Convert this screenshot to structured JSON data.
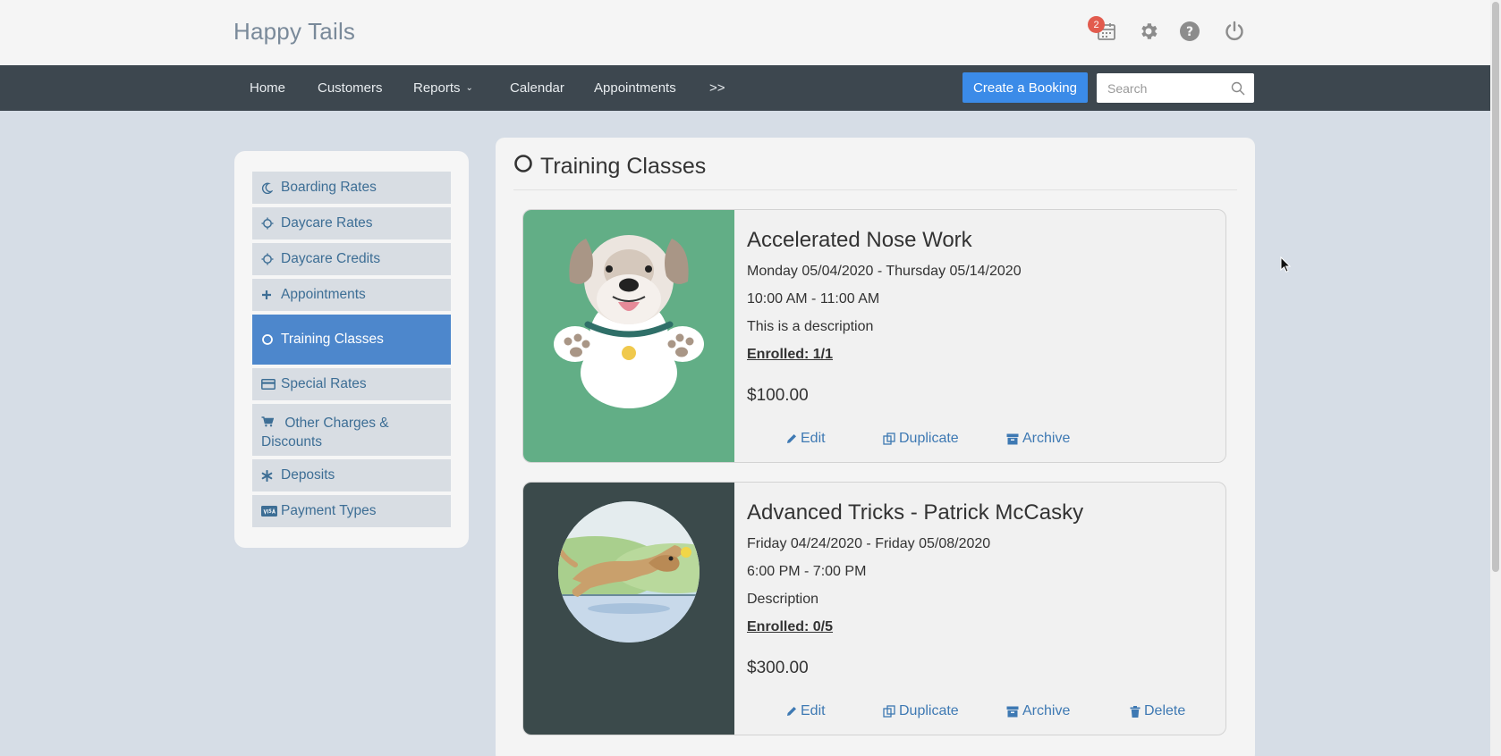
{
  "app": {
    "brand": "Happy Tails",
    "notification_count": "2",
    "colors": {
      "accent": "#3b8be8",
      "active": "#4d87cc",
      "navbar": "#3d474f"
    }
  },
  "top_icons": [
    "calendar-icon",
    "gear-icon",
    "help-icon",
    "power-icon"
  ],
  "nav": {
    "items": [
      {
        "label": "Home"
      },
      {
        "label": "Customers"
      },
      {
        "label": "Reports"
      },
      {
        "label": "Calendar"
      },
      {
        "label": "Appointments"
      },
      {
        "label": ">>"
      }
    ],
    "create_label": "Create a Booking",
    "search_placeholder": "Search"
  },
  "sidebar": {
    "items": [
      {
        "label": "Boarding Rates",
        "icon": "moon-icon"
      },
      {
        "label": "Daycare Rates",
        "icon": "sun-icon"
      },
      {
        "label": "Daycare Credits",
        "icon": "sun-icon"
      },
      {
        "label": "Appointments",
        "icon": "plus-icon"
      },
      {
        "label": "Training Classes",
        "icon": "ring-icon",
        "active": true
      },
      {
        "label": "Special Rates",
        "icon": "card-icon"
      },
      {
        "label": "Other Charges & Discounts",
        "icon": "cart-icon"
      },
      {
        "label": "Deposits",
        "icon": "asterisk-icon"
      },
      {
        "label": "Payment Types",
        "icon": "visa-icon"
      }
    ]
  },
  "main": {
    "title": "Training Classes",
    "classes": [
      {
        "name": "Accelerated Nose Work",
        "dates": "Monday 05/04/2020 - Thursday 05/14/2020",
        "time": "10:00 AM - 11:00 AM",
        "description": "This is a description",
        "enrolled": "Enrolled: 1/1",
        "price": "$100.00",
        "actions": {
          "edit": "Edit",
          "duplicate": "Duplicate",
          "archive": "Archive"
        },
        "image": "dog-face-illustration",
        "image_bg": "#62ae86"
      },
      {
        "name": "Advanced Tricks - Patrick McCasky",
        "dates": "Friday 04/24/2020 - Friday 05/08/2020",
        "time": "6:00 PM - 7:00 PM",
        "description": "Description",
        "enrolled": "Enrolled: 0/5",
        "price": "$300.00",
        "actions": {
          "edit": "Edit",
          "duplicate": "Duplicate",
          "archive": "Archive",
          "delete": "Delete"
        },
        "image": "running-dog-illustration",
        "image_bg": "#3b4a4b"
      }
    ]
  }
}
